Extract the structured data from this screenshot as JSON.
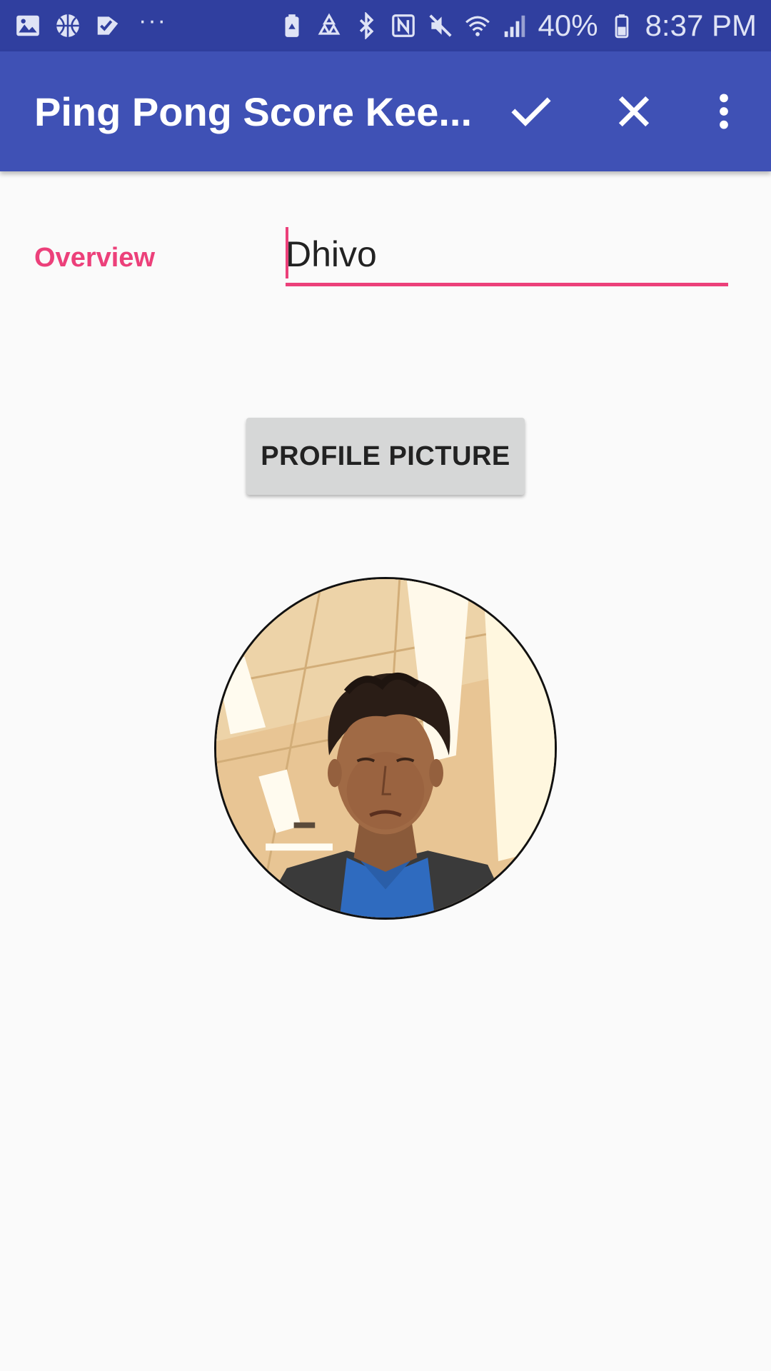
{
  "status_bar": {
    "left_icons": [
      "gallery-icon",
      "basketball-icon",
      "checklist-icon"
    ],
    "more_indicator": "···",
    "right_icons": [
      "battery-saver-icon",
      "recycle-icon",
      "bluetooth-icon",
      "nfc-icon",
      "mute-icon",
      "wifi-icon",
      "signal-icon"
    ],
    "battery_percent": "40%",
    "battery_icon": "battery-icon",
    "time": "8:37 PM"
  },
  "app_bar": {
    "title": "Ping Pong Score Kee...",
    "actions": [
      "check-icon",
      "close-icon",
      "more-vert-icon"
    ],
    "color": "#3f51b5"
  },
  "form": {
    "label": "Overview",
    "name_value": "Dhivo",
    "accent_color": "#ec407a"
  },
  "profile_button": {
    "label": "PROFILE PICTURE"
  },
  "avatar": {
    "description_icon": "profile-photo"
  }
}
